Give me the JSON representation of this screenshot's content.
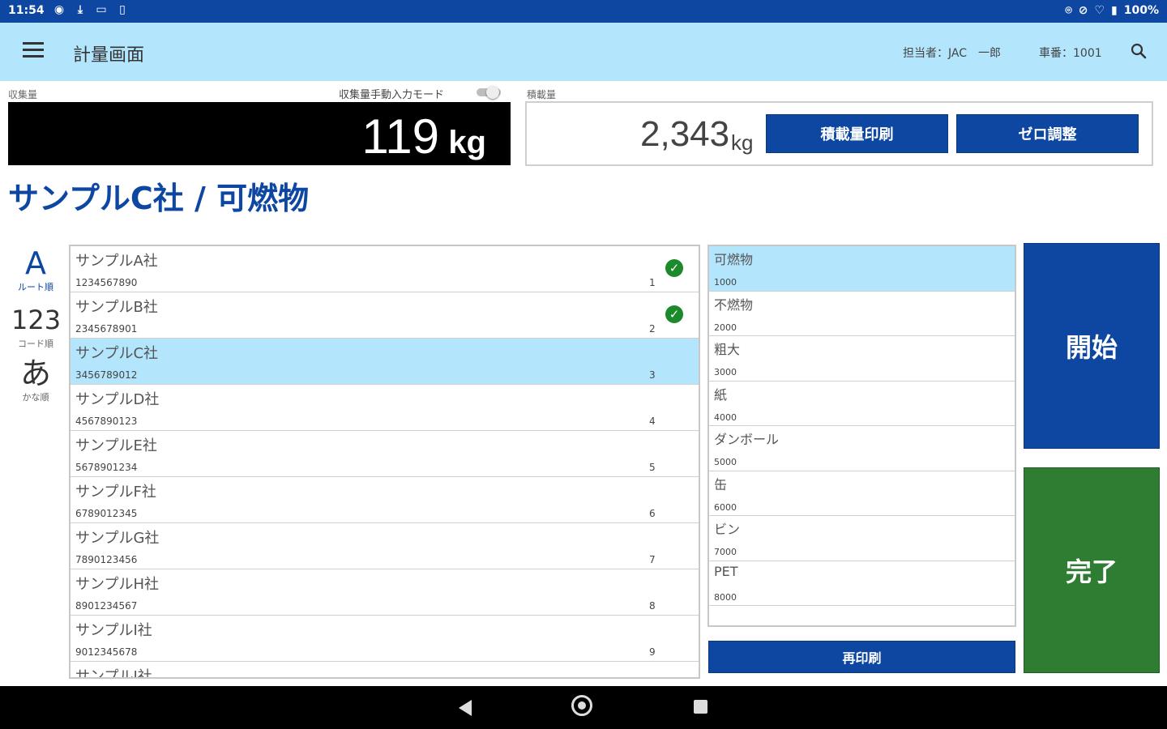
{
  "status_bar": {
    "time": "11:54",
    "left_icons": [
      "system-icon",
      "download-icon",
      "photo-icon",
      "sim-icon"
    ],
    "battery": "100%"
  },
  "app_bar": {
    "title": "計量画面",
    "staff": "担当者：JAC　一郎",
    "vehicle": "車番：1001"
  },
  "collect": {
    "label": "収集量",
    "manual_mode_label": "収集量手動入力モード",
    "manual_mode_on": false,
    "value": "119",
    "unit": "kg"
  },
  "load": {
    "label": "積載量",
    "value": "2,343",
    "unit": "kg",
    "print_button": "積載量印刷",
    "zero_button": "ゼロ調整"
  },
  "selection_title": "サンプルC社 / 可燃物",
  "sort_options": [
    {
      "glyph": "A",
      "caption": "ルート順"
    },
    {
      "glyph": "123",
      "caption": "コード順"
    },
    {
      "glyph": "あ",
      "caption": "かな順"
    }
  ],
  "customers": [
    {
      "name": "サンプルA社",
      "code": "1234567890",
      "num": "1",
      "done": true
    },
    {
      "name": "サンプルB社",
      "code": "2345678901",
      "num": "2",
      "done": true
    },
    {
      "name": "サンプルC社",
      "code": "3456789012",
      "num": "3",
      "selected": true
    },
    {
      "name": "サンプルD社",
      "code": "4567890123",
      "num": "4"
    },
    {
      "name": "サンプルE社",
      "code": "5678901234",
      "num": "5"
    },
    {
      "name": "サンプルF社",
      "code": "6789012345",
      "num": "6"
    },
    {
      "name": "サンプルG社",
      "code": "7890123456",
      "num": "7"
    },
    {
      "name": "サンプルH社",
      "code": "8901234567",
      "num": "8"
    },
    {
      "name": "サンプルI社",
      "code": "9012345678",
      "num": "9"
    },
    {
      "name": "サンプルJ社",
      "code": "",
      "num": ""
    }
  ],
  "waste_types": [
    {
      "name": "可燃物",
      "code": "1000",
      "selected": true
    },
    {
      "name": "不燃物",
      "code": "2000"
    },
    {
      "name": "粗大",
      "code": "3000"
    },
    {
      "name": "紙",
      "code": "4000"
    },
    {
      "name": "ダンボール",
      "code": "5000"
    },
    {
      "name": "缶",
      "code": "6000"
    },
    {
      "name": "ビン",
      "code": "7000"
    },
    {
      "name": "PET",
      "code": "8000"
    }
  ],
  "buttons": {
    "reprint": "再印刷",
    "start": "開始",
    "done": "完了"
  },
  "colors": {
    "primary": "#0d47a1",
    "app_bar": "#b3e5fc",
    "selected_row": "#b3e5fc",
    "done_button": "#2e7d32",
    "check": "#1b8a2a"
  }
}
